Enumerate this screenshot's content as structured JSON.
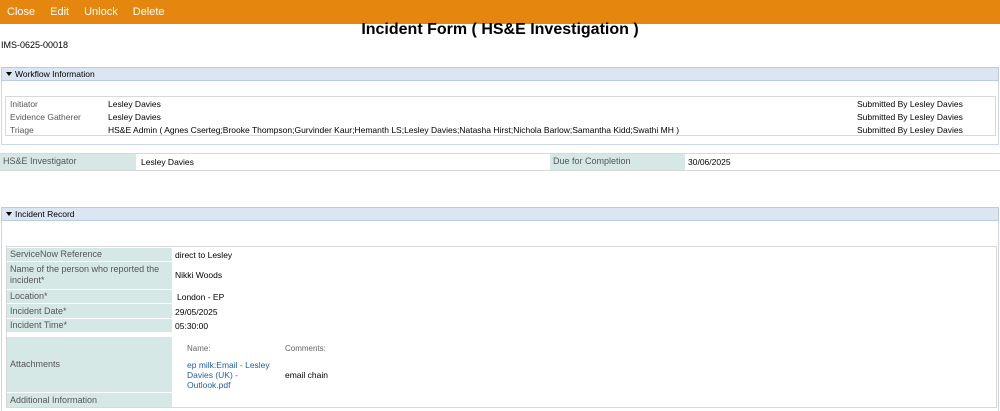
{
  "toolbar": {
    "close": "Close",
    "edit": "Edit",
    "unlock": "Unlock",
    "delete": "Delete"
  },
  "form": {
    "title": "Incident Form ( HS&E Investigation )",
    "reference": "IMS-0625-00018"
  },
  "workflow": {
    "header": "Workflow Information",
    "rows": [
      {
        "label": "Initiator",
        "value": "Lesley Davies",
        "status": "Submitted By Lesley Davies"
      },
      {
        "label": "Evidence Gatherer",
        "value": "Lesley Davies",
        "status": "Submitted By Lesley Davies"
      },
      {
        "label": "Triage",
        "value": "HS&E Admin ( Agnes Cserteg;Brooke Thompson;Gurvinder Kaur;Hemanth LS;Lesley Davies;Natasha Hirst;Nichola Barlow;Samantha Kidd;Swathi MH )",
        "status": "Submitted By Lesley Davies"
      }
    ]
  },
  "investigation": {
    "investigator_label": "HS&E Investigator",
    "investigator_value": "Lesley Davies",
    "due_label": "Due for Completion",
    "due_value": "30/06/2025"
  },
  "record": {
    "header": "Incident Record",
    "servicenow_label": "ServiceNow Reference",
    "servicenow_value": "direct to Lesley",
    "reporter_label": "Name of the person who reported the incident*",
    "reporter_value": "Nikki Woods",
    "location_label": "Location*",
    "location_value": "London - EP",
    "date_label": "Incident Date*",
    "date_value": "29/05/2025",
    "time_label": "Incident Time*",
    "time_value": "05:30:00",
    "attachments_label": "Attachments",
    "attachments_name_header": "Name:",
    "attachments_comments_header": "Comments:",
    "attachment_name": "ep milk:Email - Lesley Davies (UK) - Outlook.pdf",
    "attachment_comment": "email chain",
    "additional_label": "Additional Information"
  }
}
